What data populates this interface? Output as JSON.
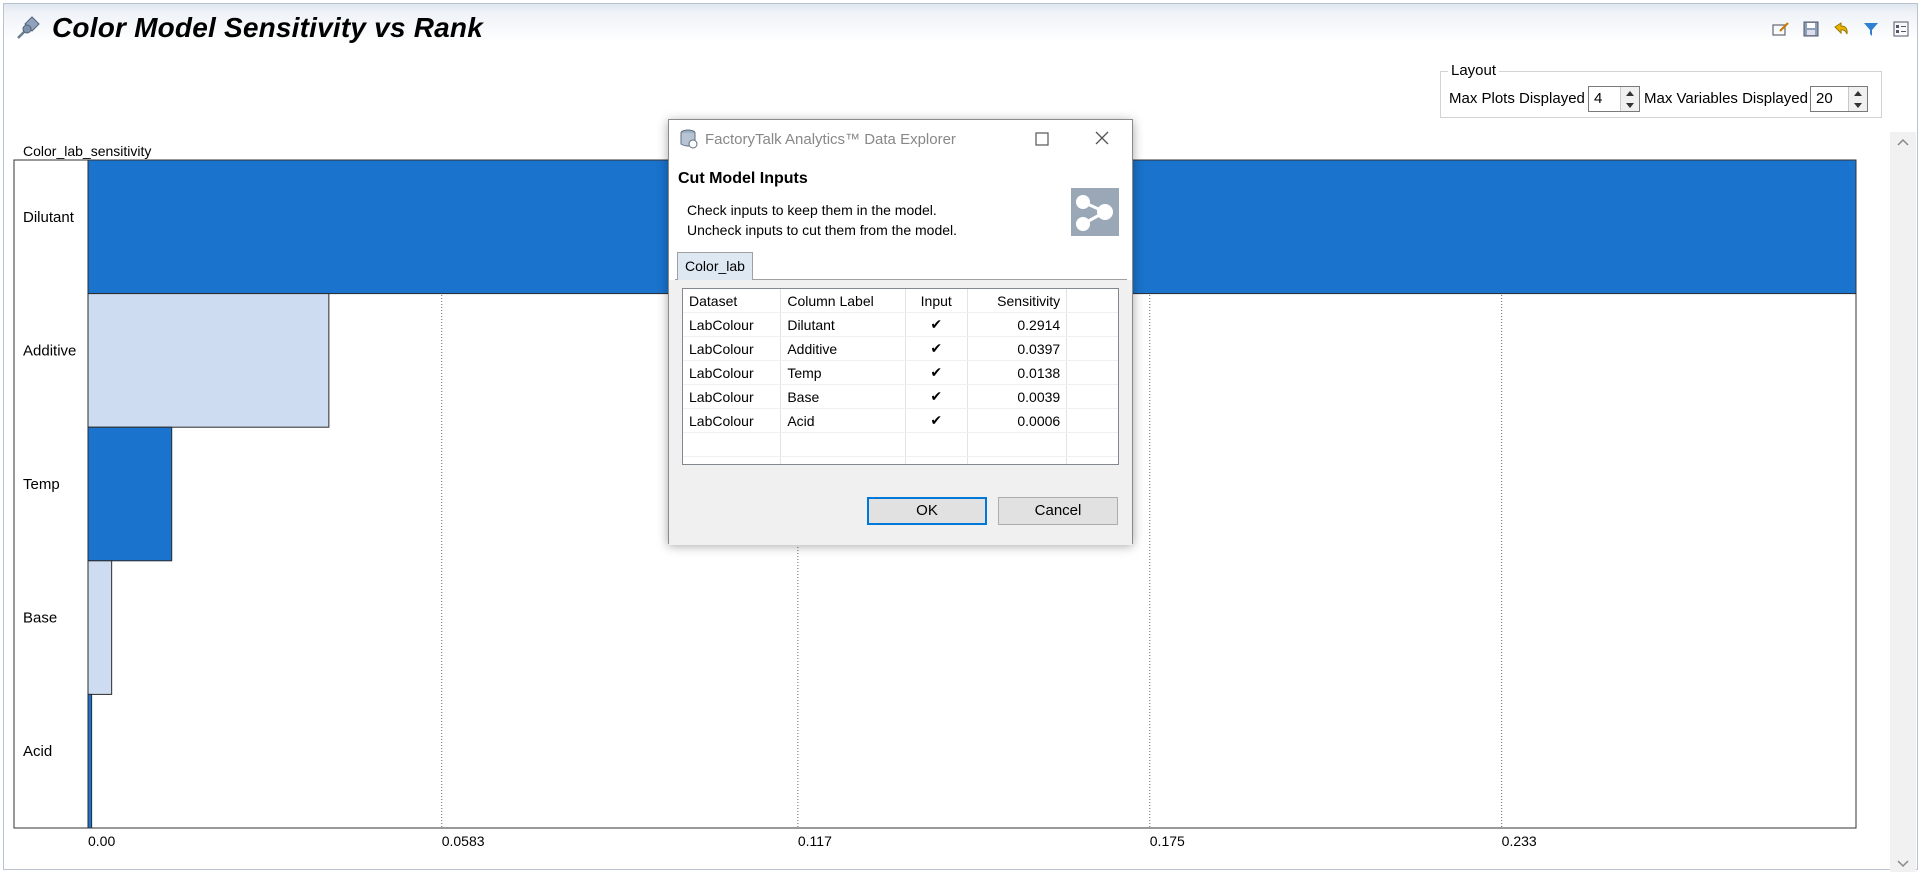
{
  "page": {
    "title": "Color Model Sensitivity vs Rank"
  },
  "toolbar": {
    "icons": [
      "edit-icon",
      "save-icon",
      "undo-icon",
      "filter-icon",
      "properties-icon"
    ]
  },
  "layout": {
    "legend": "Layout",
    "max_plots_label": "Max Plots Displayed",
    "max_plots_value": "4",
    "max_vars_label": "Max Variables Displayed",
    "max_vars_value": "20"
  },
  "chart_data": {
    "type": "bar",
    "orientation": "horizontal",
    "title": "Color_lab_sensitivity",
    "categories": [
      "Dilutant",
      "Additive",
      "Temp",
      "Base",
      "Acid"
    ],
    "values": [
      0.2914,
      0.0397,
      0.0138,
      0.0039,
      0.0006
    ],
    "bar_colors": [
      "#1a73cc",
      "#cddcf0",
      "#1a73cc",
      "#cddcf0",
      "#1a73cc"
    ],
    "xlim": [
      0,
      0.2914
    ],
    "xticks": [
      "0.00",
      "0.0583",
      "0.117",
      "0.175",
      "0.233"
    ],
    "xtick_values": [
      0,
      0.0583,
      0.117,
      0.175,
      0.233
    ],
    "grid": "vertical dotted"
  },
  "dialog": {
    "title": "FactoryTalk Analytics™ Data Explorer",
    "heading": "Cut Model Inputs",
    "message_line1": "Check inputs to keep them in the model.",
    "message_line2": "Uncheck inputs to cut them from the model.",
    "tab_label": "Color_lab",
    "columns": [
      "Dataset",
      "Column Label",
      "Input",
      "Sensitivity"
    ],
    "rows": [
      {
        "dataset": "LabColour",
        "label": "Dilutant",
        "input": true,
        "sensitivity": "0.2914"
      },
      {
        "dataset": "LabColour",
        "label": "Additive",
        "input": true,
        "sensitivity": "0.0397"
      },
      {
        "dataset": "LabColour",
        "label": "Temp",
        "input": true,
        "sensitivity": "0.0138"
      },
      {
        "dataset": "LabColour",
        "label": "Base",
        "input": true,
        "sensitivity": "0.0039"
      },
      {
        "dataset": "LabColour",
        "label": "Acid",
        "input": true,
        "sensitivity": "0.0006"
      }
    ],
    "ok_label": "OK",
    "cancel_label": "Cancel"
  }
}
